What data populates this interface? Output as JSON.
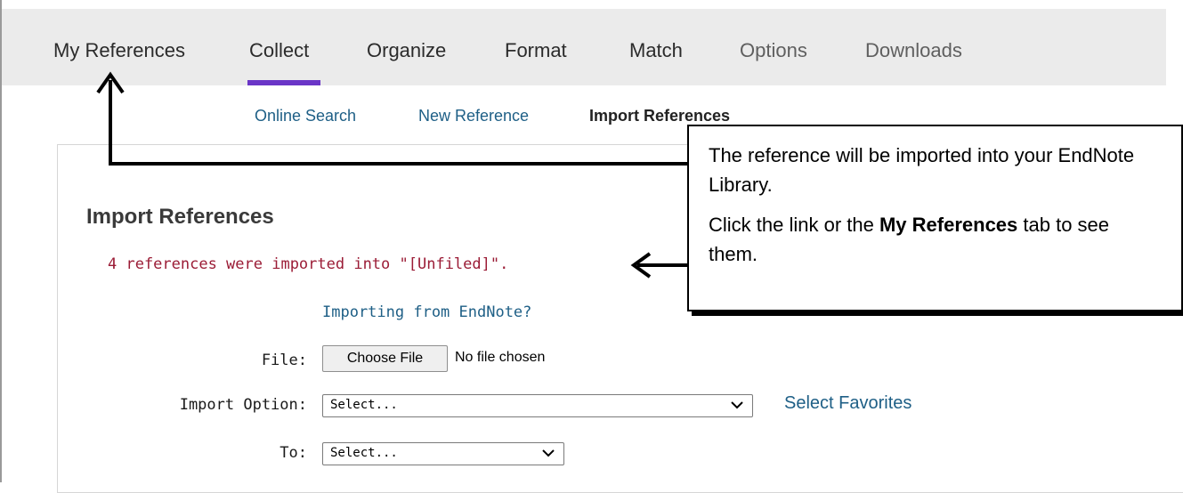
{
  "nav": {
    "tabs": [
      {
        "label": "My References"
      },
      {
        "label": "Collect"
      },
      {
        "label": "Organize"
      },
      {
        "label": "Format"
      },
      {
        "label": "Match"
      },
      {
        "label": "Options"
      },
      {
        "label": "Downloads"
      }
    ],
    "active_tab": "Collect",
    "accent_color": "#6a35c7"
  },
  "subnav": {
    "items": [
      {
        "label": "Online Search"
      },
      {
        "label": "New Reference"
      },
      {
        "label": "Import References"
      }
    ],
    "active_item": "Import References"
  },
  "main": {
    "title": "Import References",
    "status": {
      "text": "4 references were imported into \"[Unfiled]\".",
      "color": "#9b1c36"
    },
    "import_link": "Importing from EndNote?",
    "form": {
      "file_label": "File:",
      "choose_file_label": "Choose File",
      "no_file_text": "No file chosen",
      "import_option_label": "Import Option:",
      "import_option_value": "Select...",
      "to_label": "To:",
      "to_value": "Select...",
      "select_favorites": "Select Favorites"
    }
  },
  "callout": {
    "line1": "The reference will be imported into your EndNote Library.",
    "line2_prefix": "Click the link or the ",
    "line2_bold": "My References",
    "line2_suffix": " tab to see them."
  }
}
